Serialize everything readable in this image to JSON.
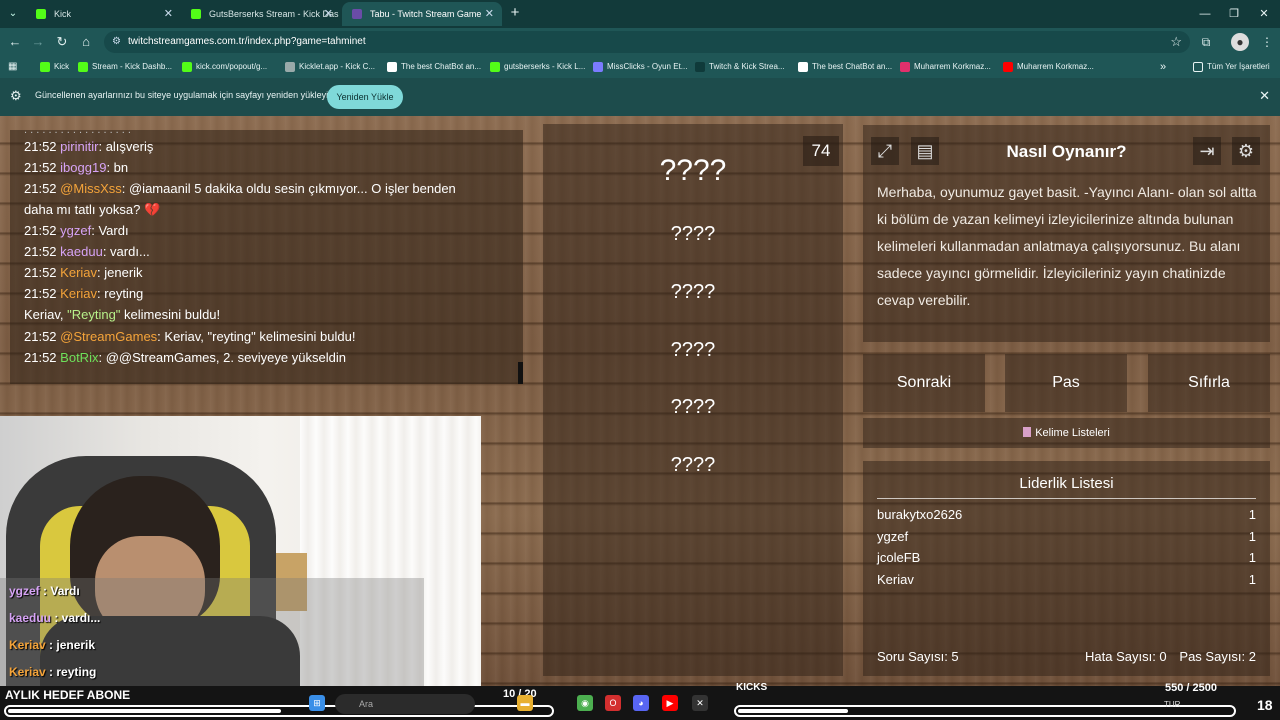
{
  "browser": {
    "tabs": [
      {
        "title": "Kick",
        "color": "#53fc18"
      },
      {
        "title": "GutsBerserks Stream - Kick Das",
        "color": "#53fc18"
      },
      {
        "title": "Tabu - Twitch Stream Game",
        "color": "#6a4ca8"
      }
    ],
    "url": "twitchstreamgames.com.tr/index.php?game=tahminet",
    "bookmarks": [
      {
        "label": "Kick",
        "color": "#53fc18"
      },
      {
        "label": "Stream - Kick Dashb...",
        "color": "#53fc18"
      },
      {
        "label": "kick.com/popout/g...",
        "color": "#53fc18"
      },
      {
        "label": "Kicklet.app - Kick C...",
        "color": "#9aa"
      },
      {
        "label": "The best ChatBot an...",
        "color": "#fff"
      },
      {
        "label": "gutsberserks - Kick L...",
        "color": "#53fc18"
      },
      {
        "label": "MissClicks - Oyun Et...",
        "color": "#7b7bff"
      },
      {
        "label": "Twitch & Kick Strea...",
        "color": "#0f3a3a"
      },
      {
        "label": "The best ChatBot an...",
        "color": "#fff"
      },
      {
        "label": "Muharrem Korkmaz...",
        "color": "#e1306c"
      },
      {
        "label": "Muharrem Korkmaz...",
        "color": "#ff0000"
      }
    ],
    "all_bookmarks": "Tüm Yer İşaretleri",
    "infobar_message": "Güncellenen ayarlarınızı bu siteye uygulamak için sayfayı yeniden yükleyin",
    "infobar_button": "Yeniden Yükle"
  },
  "chat": [
    {
      "time": "21:52",
      "user": "pirinitir",
      "color": "purple",
      "text": ": alışveriş"
    },
    {
      "time": "21:52",
      "user": "ibogg19",
      "color": "purple",
      "text": ": bn"
    },
    {
      "time": "21:52",
      "user": "@MissXss",
      "color": "orange",
      "text": ": @iamaanil 5 dakika oldu sesin çıkmıyor... O işler benden"
    },
    {
      "time": "",
      "user": "",
      "color": "",
      "text": "daha mı tatlı yoksa? 💔"
    },
    {
      "time": "21:52",
      "user": "ygzef",
      "color": "purple",
      "text": ": Vardı"
    },
    {
      "time": "21:52",
      "user": "kaeduu",
      "color": "purple",
      "text": ": vardı..."
    },
    {
      "time": "21:52",
      "user": "Keriav",
      "color": "orange",
      "text": ": jenerik"
    },
    {
      "time": "21:52",
      "user": "Keriav",
      "color": "orange",
      "text": ": reyting"
    },
    {
      "time": "",
      "user": "",
      "color": "",
      "text": ""
    },
    {
      "time": "21:52",
      "user": "@StreamGames",
      "color": "orange",
      "text": ": Keriav, \"reyting\" kelimesini buldu!"
    },
    {
      "time": "21:52",
      "user": "BotRix",
      "color": "green",
      "text": ": @@StreamGames, 2. seviyeye yükseldin"
    }
  ],
  "chat_system": {
    "a": "Keriav, ",
    "b": "\"Reyting\"",
    "c": " kelimesini buldu!"
  },
  "cam_chat": [
    {
      "user": "ygzef",
      "text": " : Vardı",
      "color": "purple"
    },
    {
      "user": "kaeduu",
      "text": " : vardı...",
      "color": "purple"
    },
    {
      "user": "Keriav",
      "text": " : jenerik",
      "color": "orange"
    },
    {
      "user": "Keriav",
      "text": " : reyting",
      "color": "orange"
    }
  ],
  "game": {
    "timer": "74",
    "main_word": "????",
    "banned_words": [
      "????",
      "????",
      "????",
      "????",
      "????"
    ]
  },
  "how_to": {
    "title": "Nasıl Oynanır?",
    "description": "Merhaba, oyunumuz gayet basit. -Yayıncı Alanı- olan sol altta ki bölüm de yazan kelimeyi izleyicilerinize altında bulunan kelimeleri kullanmadan anlatmaya çalışıyorsunuz. Bu alanı sadece yayıncı görmelidir. İzleyicileriniz yayın chatinizde cevap verebilir."
  },
  "buttons": {
    "next": "Sonraki",
    "pass": "Pas",
    "reset": "Sıfırla",
    "word_lists": "Kelime Listeleri"
  },
  "leaderboard": {
    "title": "Liderlik Listesi",
    "rows": [
      {
        "name": "burakytxo2626",
        "score": "1"
      },
      {
        "name": "ygzef",
        "score": "1"
      },
      {
        "name": "jcoleFB",
        "score": "1"
      },
      {
        "name": "Keriav",
        "score": "1"
      }
    ],
    "questions": "Soru Sayısı: 5",
    "errors": "Hata Sayısı: 0",
    "passes": "Pas Sayısı: 2"
  },
  "overlay": {
    "goal_label": "AYLIK HEDEF ABONE",
    "goal_count": "10 / 20",
    "goal_progress": 0.5,
    "kicks_label": "KICKS",
    "kicks_count": "550 / 2500",
    "kicks_progress": 0.22,
    "taskbar_search": "Ara",
    "lang": "TUR",
    "number": "18"
  }
}
